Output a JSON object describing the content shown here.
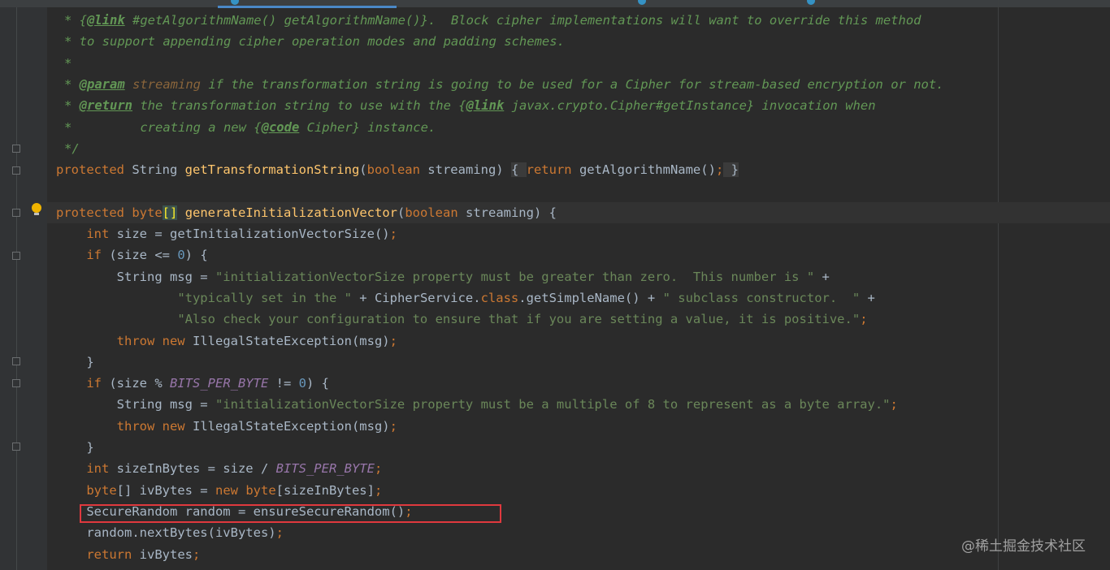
{
  "editor": {
    "lines": [
      {
        "segments": [
          {
            "t": "* {",
            "c": "cmt"
          },
          {
            "t": "@link",
            "c": "tag"
          },
          {
            "t": " #getAlgorithmName() getAlgorithmName()}.  Block cipher implementations will want to override this method",
            "c": "cmt"
          }
        ]
      },
      {
        "segments": [
          {
            "t": "* to support appending cipher operation modes and padding schemes.",
            "c": "cmt"
          }
        ]
      },
      {
        "segments": [
          {
            "t": "*",
            "c": "cmt"
          }
        ]
      },
      {
        "segments": [
          {
            "t": "* ",
            "c": "cmt"
          },
          {
            "t": "@param",
            "c": "tag"
          },
          {
            "t": " streaming",
            "c": "tagparam"
          },
          {
            "t": " if the transformation string is going to be used for a Cipher for stream-based encryption or not.",
            "c": "cmt"
          }
        ]
      },
      {
        "segments": [
          {
            "t": "* ",
            "c": "cmt"
          },
          {
            "t": "@return",
            "c": "tag"
          },
          {
            "t": " the transformation string to use with the {",
            "c": "cmt"
          },
          {
            "t": "@link",
            "c": "tag"
          },
          {
            "t": " javax.crypto.Cipher#getInstance} invocation when",
            "c": "cmt"
          }
        ]
      },
      {
        "segments": [
          {
            "t": "*         creating a new {",
            "c": "cmt"
          },
          {
            "t": "@code",
            "c": "tag"
          },
          {
            "t": " Cipher} instance.",
            "c": "cmt"
          }
        ]
      },
      {
        "segments": [
          {
            "t": "*/",
            "c": "cmt"
          }
        ]
      },
      {
        "segments": [
          {
            "t": "protected",
            "c": "kw"
          },
          {
            "t": " String ",
            "c": ""
          },
          {
            "t": "getTransformationString",
            "c": "fn"
          },
          {
            "t": "(",
            "c": ""
          },
          {
            "t": "boolean",
            "c": "kw"
          },
          {
            "t": " streaming) ",
            "c": ""
          },
          {
            "t": "{ ",
            "c": "fold-brace"
          },
          {
            "t": "return",
            "c": "kw"
          },
          {
            "t": " getAlgorithmName()",
            "c": ""
          },
          {
            "t": ";",
            "c": "kw"
          },
          {
            "t": " }",
            "c": "fold-brace"
          }
        ]
      },
      {
        "segments": []
      },
      {
        "segments": [
          {
            "t": "protected",
            "c": "kw"
          },
          {
            "t": " byte",
            "c": "kw"
          },
          {
            "t": "[]",
            "c": "brk"
          },
          {
            "t": " ",
            "c": ""
          },
          {
            "t": "generateInitializationVector",
            "c": "fn"
          },
          {
            "t": "(",
            "c": ""
          },
          {
            "t": "boolean",
            "c": "kw"
          },
          {
            "t": " streaming) {",
            "c": ""
          }
        ]
      },
      {
        "segments": [
          {
            "t": "    ",
            "c": ""
          },
          {
            "t": "int",
            "c": "kw"
          },
          {
            "t": " size = getInitializationVectorSize()",
            "c": ""
          },
          {
            "t": ";",
            "c": "kw"
          }
        ]
      },
      {
        "segments": [
          {
            "t": "    ",
            "c": ""
          },
          {
            "t": "if",
            "c": "kw"
          },
          {
            "t": " (size <= ",
            "c": ""
          },
          {
            "t": "0",
            "c": "num"
          },
          {
            "t": ") {",
            "c": ""
          }
        ]
      },
      {
        "segments": [
          {
            "t": "        String msg = ",
            "c": ""
          },
          {
            "t": "\"initializationVectorSize property must be greater than zero.  This number is \"",
            "c": "str"
          },
          {
            "t": " +",
            "c": ""
          }
        ]
      },
      {
        "segments": [
          {
            "t": "                ",
            "c": ""
          },
          {
            "t": "\"typically set in the \"",
            "c": "str"
          },
          {
            "t": " + CipherService.",
            "c": ""
          },
          {
            "t": "class",
            "c": "kw"
          },
          {
            "t": ".getSimpleName() + ",
            "c": ""
          },
          {
            "t": "\" subclass constructor.  \"",
            "c": "str"
          },
          {
            "t": " +",
            "c": ""
          }
        ]
      },
      {
        "segments": [
          {
            "t": "                ",
            "c": ""
          },
          {
            "t": "\"Also check your configuration to ensure that if you are setting a value, it is positive.\"",
            "c": "str"
          },
          {
            "t": ";",
            "c": "kw"
          }
        ]
      },
      {
        "segments": [
          {
            "t": "        ",
            "c": ""
          },
          {
            "t": "throw new",
            "c": "kw"
          },
          {
            "t": " IllegalStateException(msg)",
            "c": ""
          },
          {
            "t": ";",
            "c": "kw"
          }
        ]
      },
      {
        "segments": [
          {
            "t": "    }",
            "c": ""
          }
        ]
      },
      {
        "segments": [
          {
            "t": "    ",
            "c": ""
          },
          {
            "t": "if",
            "c": "kw"
          },
          {
            "t": " (size % ",
            "c": ""
          },
          {
            "t": "BITS_PER_BYTE",
            "c": "const"
          },
          {
            "t": " != ",
            "c": ""
          },
          {
            "t": "0",
            "c": "num"
          },
          {
            "t": ") {",
            "c": ""
          }
        ]
      },
      {
        "segments": [
          {
            "t": "        String msg = ",
            "c": ""
          },
          {
            "t": "\"initializationVectorSize property must be a multiple of 8 to represent as a byte array.\"",
            "c": "str"
          },
          {
            "t": ";",
            "c": "kw"
          }
        ]
      },
      {
        "segments": [
          {
            "t": "        ",
            "c": ""
          },
          {
            "t": "throw new",
            "c": "kw"
          },
          {
            "t": " IllegalStateException(msg)",
            "c": ""
          },
          {
            "t": ";",
            "c": "kw"
          }
        ]
      },
      {
        "segments": [
          {
            "t": "    }",
            "c": ""
          }
        ]
      },
      {
        "segments": [
          {
            "t": "    ",
            "c": ""
          },
          {
            "t": "int",
            "c": "kw"
          },
          {
            "t": " sizeInBytes = size / ",
            "c": ""
          },
          {
            "t": "BITS_PER_BYTE",
            "c": "const"
          },
          {
            "t": ";",
            "c": "kw"
          }
        ]
      },
      {
        "segments": [
          {
            "t": "    ",
            "c": ""
          },
          {
            "t": "byte",
            "c": "kw"
          },
          {
            "t": "[] ivBytes = ",
            "c": ""
          },
          {
            "t": "new",
            "c": "kw"
          },
          {
            "t": " ",
            "c": ""
          },
          {
            "t": "byte",
            "c": "kw"
          },
          {
            "t": "[sizeInBytes]",
            "c": ""
          },
          {
            "t": ";",
            "c": "kw"
          }
        ]
      },
      {
        "segments": [
          {
            "t": "    SecureRandom random = ensureSecureRandom()",
            "c": ""
          },
          {
            "t": ";",
            "c": "kw"
          }
        ]
      },
      {
        "segments": [
          {
            "t": "    random.nextBytes(ivBytes)",
            "c": ""
          },
          {
            "t": ";",
            "c": "kw"
          }
        ]
      },
      {
        "segments": [
          {
            "t": "    ",
            "c": ""
          },
          {
            "t": "return",
            "c": "kw"
          },
          {
            "t": " ivBytes",
            "c": ""
          },
          {
            "t": ";",
            "c": "kw"
          }
        ]
      }
    ]
  },
  "icons": {
    "intention": "lightbulb-icon",
    "fold": "fold-marker-icon"
  },
  "colors": {
    "background": "#2b2b2b",
    "keyword": "#cc7832",
    "string": "#6a8759",
    "function": "#ffc66d",
    "comment": "#629755",
    "highlight_box": "#e0393e"
  },
  "watermark": "@稀土掘金技术社区"
}
